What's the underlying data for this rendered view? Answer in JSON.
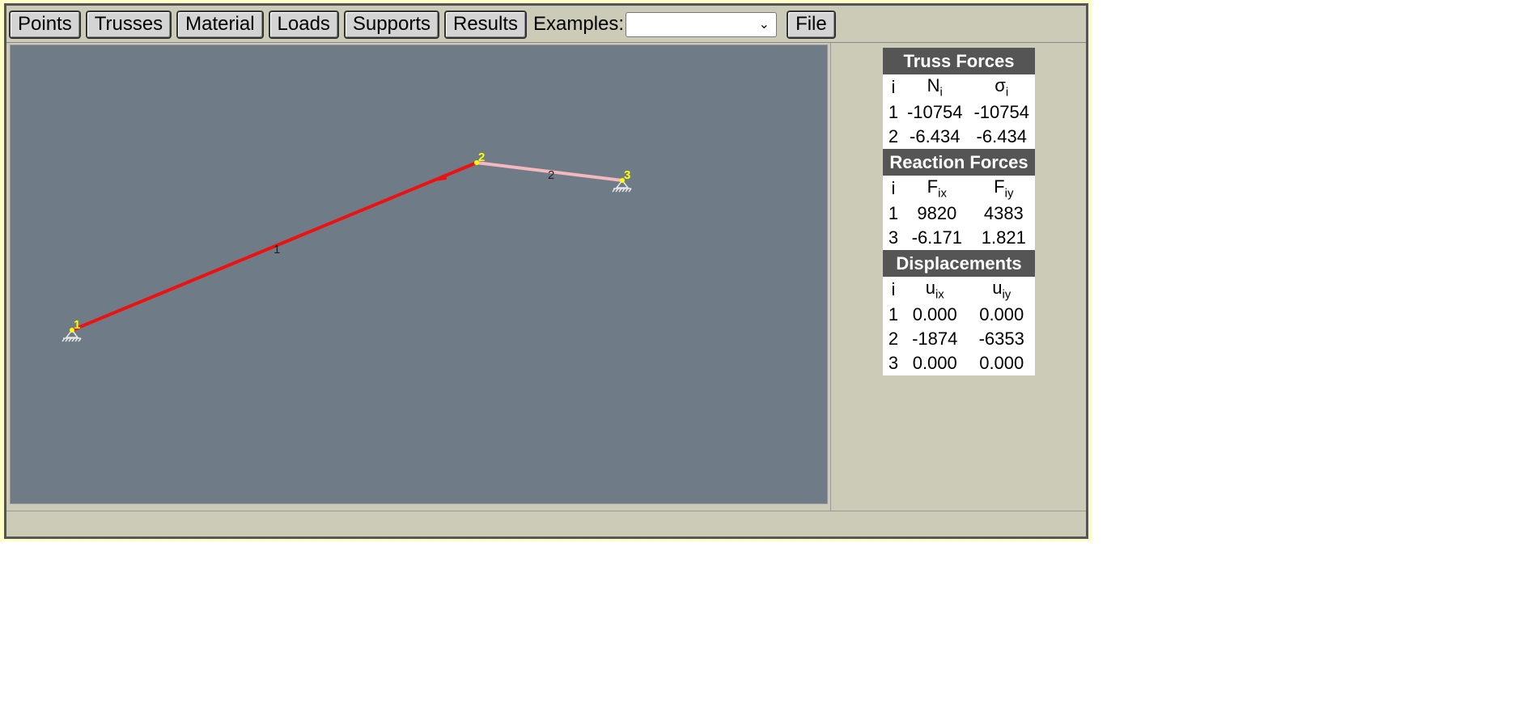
{
  "toolbar": {
    "buttons": [
      "Points",
      "Trusses",
      "Material",
      "Loads",
      "Supports",
      "Results"
    ],
    "examples_label": "Examples:",
    "examples_value": "",
    "file_label": "File"
  },
  "canvas": {
    "nodes": [
      {
        "id": "1",
        "label": "1"
      },
      {
        "id": "2",
        "label": "2"
      },
      {
        "id": "3",
        "label": "3"
      }
    ],
    "members": [
      {
        "id": "1",
        "label": "1",
        "from": "1",
        "to": "2",
        "color": "#ee1111"
      },
      {
        "id": "2",
        "label": "2",
        "from": "2",
        "to": "3",
        "color": "#f5b8bf"
      }
    ],
    "colors": {
      "background": "#6f7b86",
      "node_label": "#ffff00",
      "support": "#dddddd",
      "load": "#ee1111"
    }
  },
  "results": {
    "truss_forces": {
      "title": "Truss Forces",
      "col_i": "i",
      "col_a": "N",
      "col_a_sub": "i",
      "col_b": "σ",
      "col_b_sub": "i",
      "rows": [
        {
          "i": "1",
          "a": "-10754",
          "b": "-10754"
        },
        {
          "i": "2",
          "a": "-6.434",
          "b": "-6.434"
        }
      ]
    },
    "reaction_forces": {
      "title": "Reaction Forces",
      "col_i": "i",
      "col_a": "F",
      "col_a_sub": "ix",
      "col_b": "F",
      "col_b_sub": "iy",
      "rows": [
        {
          "i": "1",
          "a": "9820",
          "b": "4383"
        },
        {
          "i": "3",
          "a": "-6.171",
          "b": "1.821"
        }
      ]
    },
    "displacements": {
      "title": "Displacements",
      "col_i": "i",
      "col_a": "u",
      "col_a_sub": "ix",
      "col_b": "u",
      "col_b_sub": "iy",
      "rows": [
        {
          "i": "1",
          "a": "0.000",
          "b": "0.000"
        },
        {
          "i": "2",
          "a": "-1874",
          "b": "-6353"
        },
        {
          "i": "3",
          "a": "0.000",
          "b": "0.000"
        }
      ]
    }
  }
}
